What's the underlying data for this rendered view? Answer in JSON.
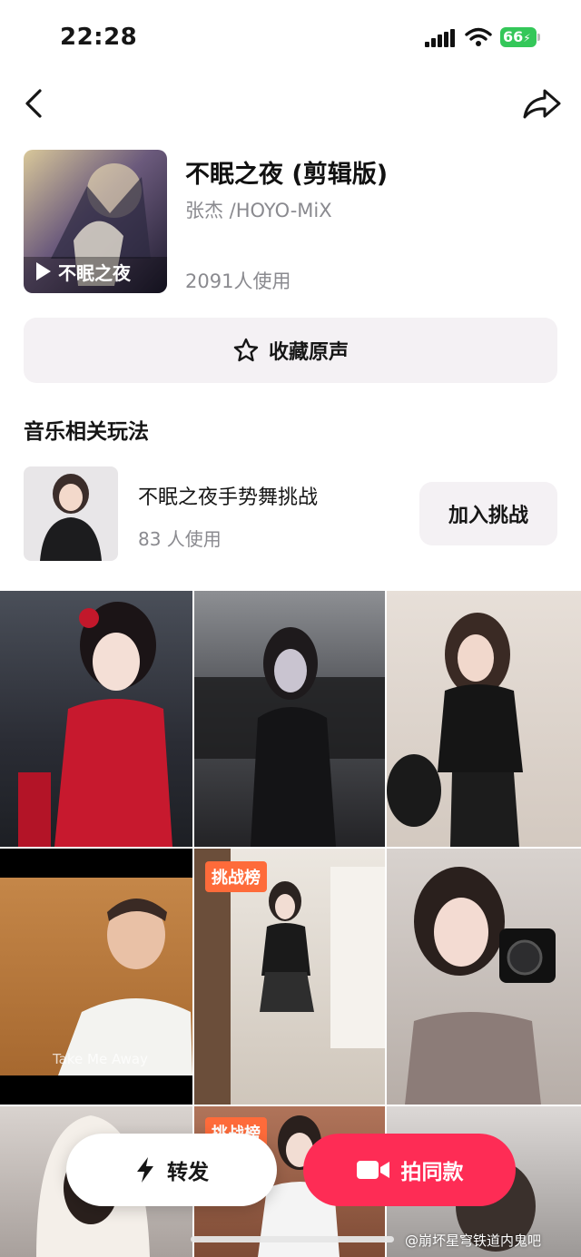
{
  "status_bar": {
    "time": "22:28",
    "battery": "66"
  },
  "song": {
    "title": "不眠之夜 (剪辑版)",
    "artist": "张杰 /HOYO-MiX",
    "uses": "2091人使用",
    "cover_text": "不眠之夜"
  },
  "favorite_button": {
    "label": "收藏原声"
  },
  "related_section": {
    "title": "音乐相关玩法"
  },
  "challenge": {
    "title": "不眠之夜手势舞挑战",
    "uses": "83 人使用",
    "join_label": "加入挑战"
  },
  "grid": {
    "badge_label": "挑战榜",
    "overlay_caption": "Take Me Away"
  },
  "actions": {
    "forward_label": "转发",
    "shoot_label": "拍同款"
  },
  "watermark": "@崩坏星穹铁道内鬼吧",
  "colors": {
    "accent": "#fe2c55",
    "badge": "#fe6b3a",
    "muted_text": "#8a8a8f",
    "button_bg": "#f4f1f4"
  }
}
